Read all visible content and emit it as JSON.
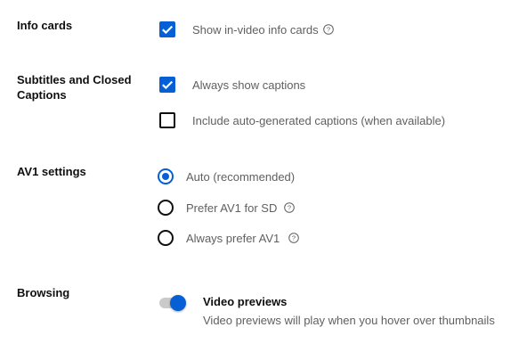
{
  "sections": {
    "info_cards": {
      "title": "Info cards",
      "options": [
        {
          "label": "Show in-video info cards",
          "checked": true,
          "help_icon": "help-circle-icon"
        }
      ]
    },
    "subtitles": {
      "title": "Subtitles and Closed Captions",
      "title_line1": "Subtitles and Closed",
      "title_line2": "Captions",
      "options": [
        {
          "label": "Always show captions",
          "checked": true
        },
        {
          "label": "Include auto-generated captions (when available)",
          "checked": false
        }
      ]
    },
    "av1": {
      "title": "AV1 settings",
      "selected": "Auto (recommended)",
      "options": [
        {
          "label": "Auto (recommended)",
          "selected": true
        },
        {
          "label": "Prefer AV1 for SD",
          "selected": false,
          "help_icon": "help-circle-icon"
        },
        {
          "label": "Always prefer AV1",
          "selected": false,
          "help_icon": "help-circle-icon"
        }
      ]
    },
    "browsing": {
      "title": "Browsing",
      "toggle": {
        "label": "Video previews",
        "description": "Video previews will play when you hover over thumbnails",
        "on": true
      }
    }
  },
  "colors": {
    "accent": "#065fd4",
    "text_primary": "#0f0f0f",
    "text_secondary": "#606060"
  }
}
